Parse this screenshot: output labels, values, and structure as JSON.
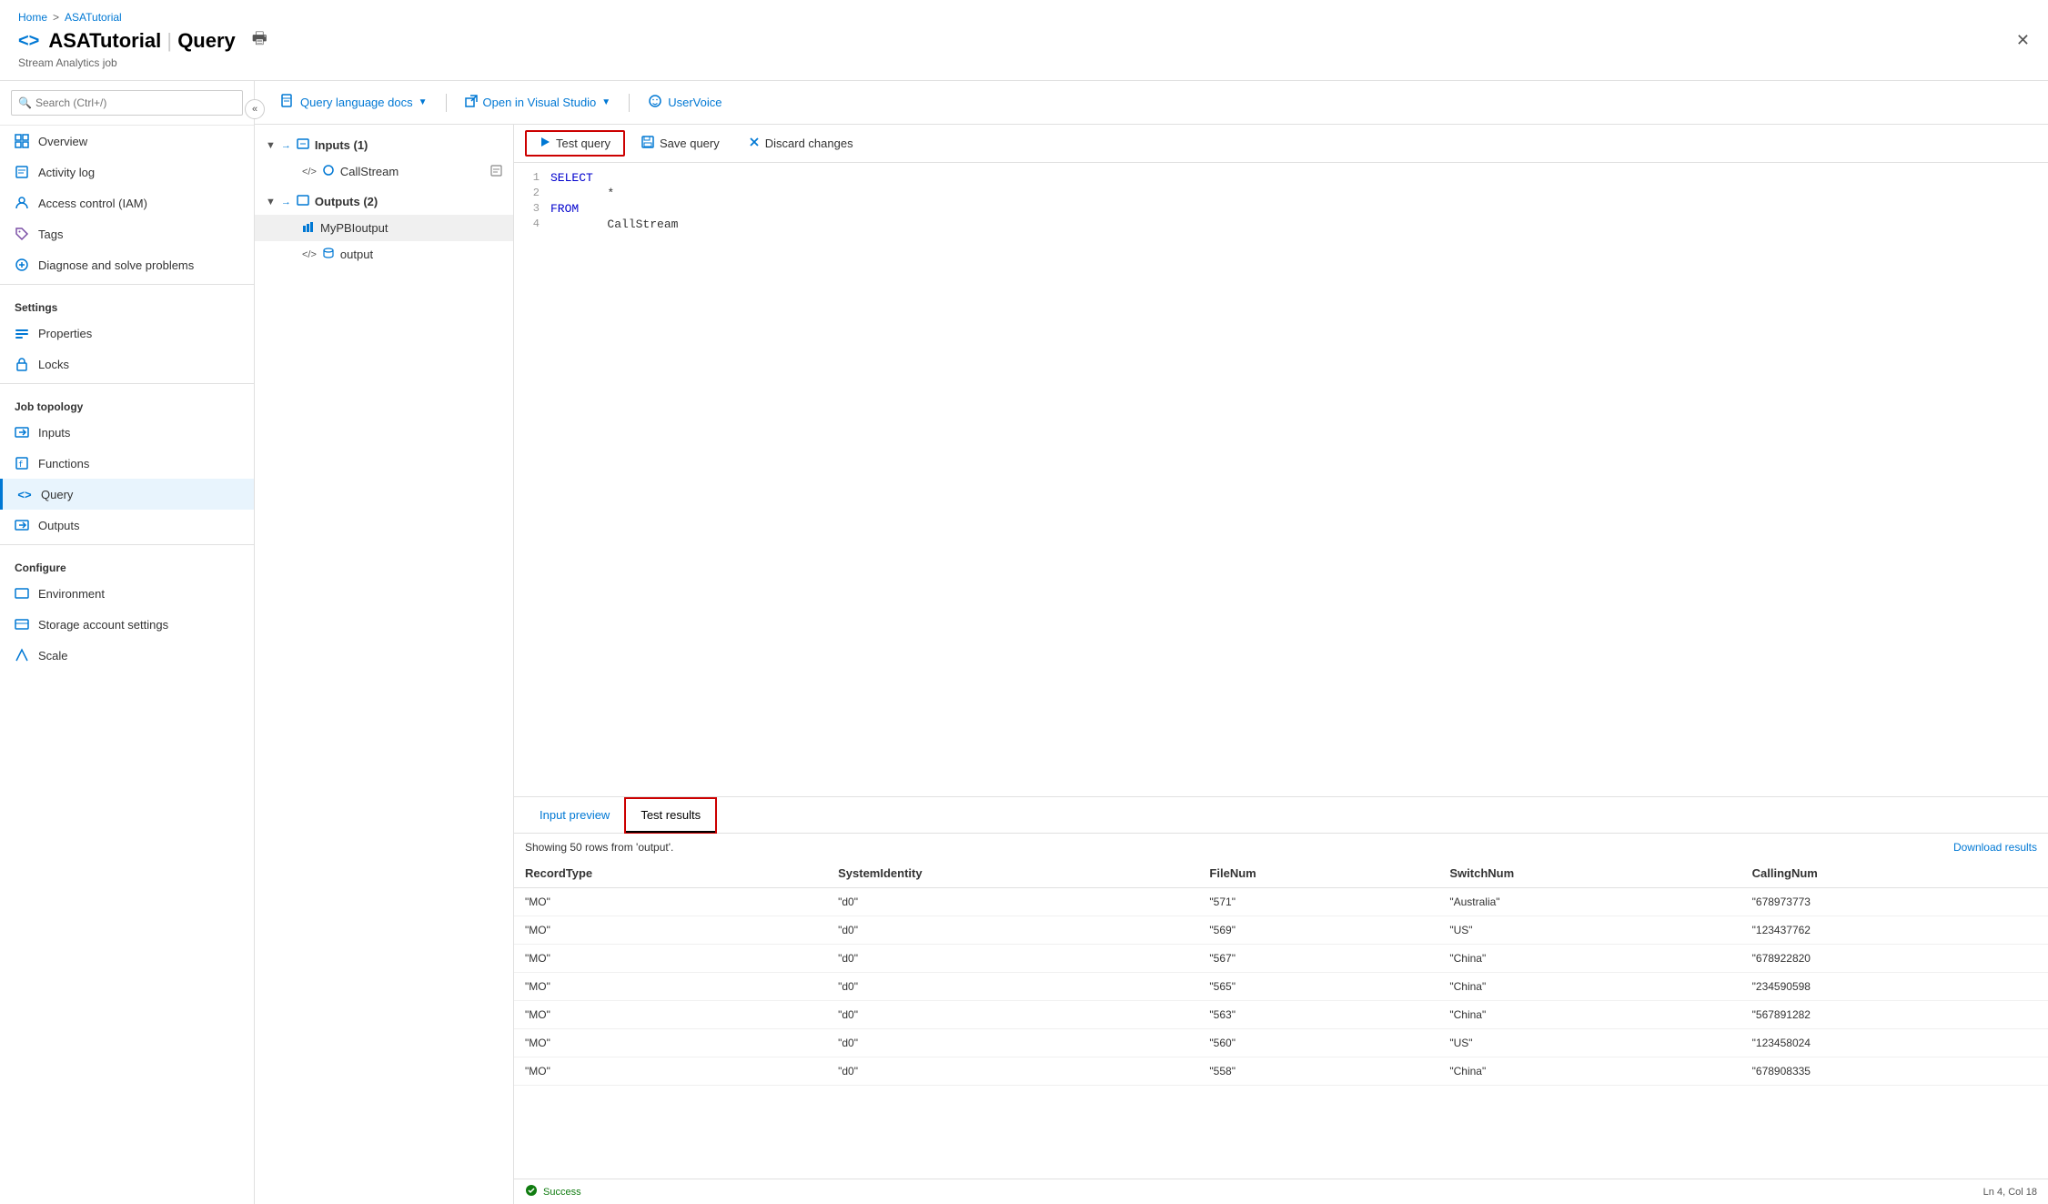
{
  "breadcrumb": {
    "home": "Home",
    "separator": ">",
    "current": "ASATutorial"
  },
  "header": {
    "icon": "<>",
    "title": "ASATutorial",
    "divider": "|",
    "page": "Query",
    "subtitle": "Stream Analytics job",
    "print_icon": "🖨",
    "close_icon": "✕"
  },
  "search": {
    "placeholder": "Search (Ctrl+/)"
  },
  "sidebar": {
    "nav_items": [
      {
        "id": "overview",
        "label": "Overview",
        "icon": "grid"
      },
      {
        "id": "activity-log",
        "label": "Activity log",
        "icon": "list"
      },
      {
        "id": "access-control",
        "label": "Access control (IAM)",
        "icon": "person"
      },
      {
        "id": "tags",
        "label": "Tags",
        "icon": "tag"
      },
      {
        "id": "diagnose",
        "label": "Diagnose and solve problems",
        "icon": "wrench"
      }
    ],
    "settings_title": "Settings",
    "settings_items": [
      {
        "id": "properties",
        "label": "Properties",
        "icon": "props"
      },
      {
        "id": "locks",
        "label": "Locks",
        "icon": "lock"
      }
    ],
    "job_topology_title": "Job topology",
    "job_topology_items": [
      {
        "id": "inputs",
        "label": "Inputs",
        "icon": "inputs"
      },
      {
        "id": "functions",
        "label": "Functions",
        "icon": "functions"
      },
      {
        "id": "query",
        "label": "Query",
        "icon": "query",
        "active": true
      },
      {
        "id": "outputs",
        "label": "Outputs",
        "icon": "outputs"
      }
    ],
    "configure_title": "Configure",
    "configure_items": [
      {
        "id": "environment",
        "label": "Environment",
        "icon": "env"
      },
      {
        "id": "storage-account",
        "label": "Storage account settings",
        "icon": "storage"
      },
      {
        "id": "scale",
        "label": "Scale",
        "icon": "scale"
      }
    ]
  },
  "toolbar": {
    "query_lang_docs": "Query language docs",
    "open_vs": "Open in Visual Studio",
    "uservoice": "UserVoice"
  },
  "tree": {
    "inputs_label": "Inputs (1)",
    "inputs_child": "CallStream",
    "outputs_label": "Outputs (2)",
    "outputs_children": [
      "MyPBIoutput",
      "output"
    ]
  },
  "query_actions": {
    "test_query": "Test query",
    "save_query": "Save query",
    "discard_changes": "Discard changes"
  },
  "code": {
    "lines": [
      {
        "num": "1",
        "content": "SELECT",
        "type": "keyword"
      },
      {
        "num": "2",
        "content": "        *",
        "type": "star"
      },
      {
        "num": "3",
        "content": "FROM",
        "type": "keyword"
      },
      {
        "num": "4",
        "content": "        CallStream",
        "type": "table"
      }
    ]
  },
  "results": {
    "tab_input_preview": "Input preview",
    "tab_test_results": "Test results",
    "active_tab": "test_results",
    "info_text": "Showing 50 rows from 'output'.",
    "download_label": "Download results",
    "columns": [
      "RecordType",
      "SystemIdentity",
      "FileNum",
      "SwitchNum",
      "CallingNum"
    ],
    "rows": [
      {
        "RecordType": "\"MO\"",
        "SystemIdentity": "\"d0\"",
        "FileNum": "\"571\"",
        "SwitchNum": "\"Australia\"",
        "CallingNum": "\"678973773"
      },
      {
        "RecordType": "\"MO\"",
        "SystemIdentity": "\"d0\"",
        "FileNum": "\"569\"",
        "SwitchNum": "\"US\"",
        "CallingNum": "\"123437762"
      },
      {
        "RecordType": "\"MO\"",
        "SystemIdentity": "\"d0\"",
        "FileNum": "\"567\"",
        "SwitchNum": "\"China\"",
        "CallingNum": "\"678922820"
      },
      {
        "RecordType": "\"MO\"",
        "SystemIdentity": "\"d0\"",
        "FileNum": "\"565\"",
        "SwitchNum": "\"China\"",
        "CallingNum": "\"234590598"
      },
      {
        "RecordType": "\"MO\"",
        "SystemIdentity": "\"d0\"",
        "FileNum": "\"563\"",
        "SwitchNum": "\"China\"",
        "CallingNum": "\"567891282"
      },
      {
        "RecordType": "\"MO\"",
        "SystemIdentity": "\"d0\"",
        "FileNum": "\"560\"",
        "SwitchNum": "\"US\"",
        "CallingNum": "\"123458024"
      },
      {
        "RecordType": "\"MO\"",
        "SystemIdentity": "\"d0\"",
        "FileNum": "\"558\"",
        "SwitchNum": "\"China\"",
        "CallingNum": "\"678908335"
      }
    ]
  },
  "status": {
    "success": "Success",
    "position": "Ln 4, Col 18"
  }
}
